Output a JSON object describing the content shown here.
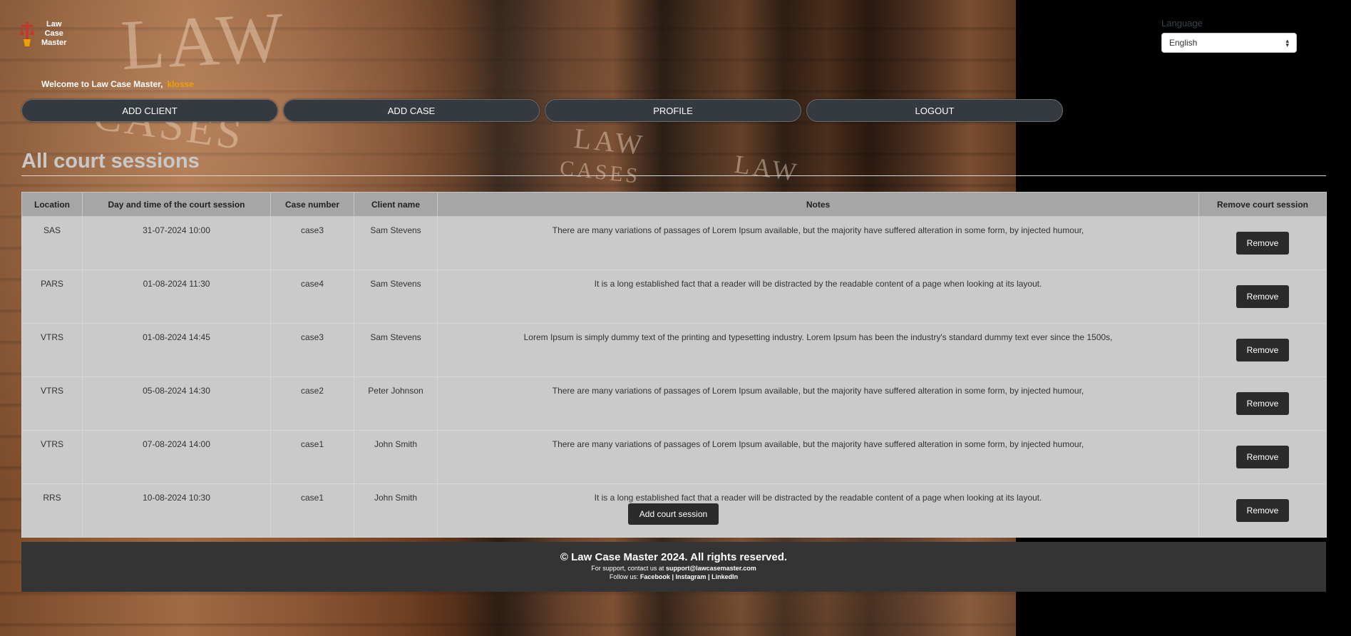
{
  "logo": {
    "line1": "Law",
    "line2": "Case",
    "line3": "Master"
  },
  "language": {
    "label": "Language",
    "selected": "English"
  },
  "welcome": {
    "text": "Welcome to Law Case Master,",
    "username": "klosse"
  },
  "nav": {
    "add_client": "ADD CLIENT",
    "add_case": "ADD CASE",
    "profile": "PROFILE",
    "logout": "LOGOUT"
  },
  "page_title": "All court sessions",
  "table": {
    "headers": [
      "Location",
      "Day and time of the court session",
      "Case number",
      "Client name",
      "Notes",
      "Remove court session"
    ],
    "rows": [
      [
        "SAS",
        "31-07-2024 10:00",
        "case3",
        "Sam Stevens",
        "There are many variations of passages of Lorem Ipsum available, but the majority have suffered alteration in some form, by injected humour,",
        "Remove"
      ],
      [
        "PARS",
        "01-08-2024 11:30",
        "case4",
        "Sam Stevens",
        "It is a long established fact that a reader will be distracted by the readable content of a page when looking at its layout.",
        "Remove"
      ],
      [
        "VTRS",
        "01-08-2024 14:45",
        "case3",
        "Sam Stevens",
        "Lorem Ipsum is simply dummy text of the printing and typesetting industry. Lorem Ipsum has been the industry's standard dummy text ever since the 1500s,",
        "Remove"
      ],
      [
        "VTRS",
        "05-08-2024 14:30",
        "case2",
        "Peter Johnson",
        "There are many variations of passages of Lorem Ipsum available, but the majority have suffered alteration in some form, by injected humour,",
        "Remove"
      ],
      [
        "VTRS",
        "07-08-2024 14:00",
        "case1",
        "John Smith",
        "There are many variations of passages of Lorem Ipsum available, but the majority have suffered alteration in some form, by injected humour,",
        "Remove"
      ],
      [
        "RRS",
        "10-08-2024 10:30",
        "case1",
        "John Smith",
        "It is a long established fact that a reader will be distracted by the readable content of a page when looking at its layout.",
        "Remove"
      ]
    ]
  },
  "add_session_label": "Add court session",
  "background_text": {
    "big": "LAW",
    "cases": "CASES",
    "spine1_a": "LAW",
    "spine1_b": "CASES",
    "spine2": "LAW"
  },
  "footer": {
    "copyright": "© Law Case Master 2024. All rights reserved.",
    "support_prefix": "For support, contact us at",
    "support_email": "support@lawcasemaster.com",
    "follow_prefix": "Follow us:",
    "facebook": "Facebook",
    "sep": "|",
    "instagram": "Instagram",
    "linkedin": "LinkedIn"
  },
  "colors": {
    "accent": "#f0a000",
    "button_dark": "#2b2b2b",
    "nav_bg": "#343a40"
  }
}
